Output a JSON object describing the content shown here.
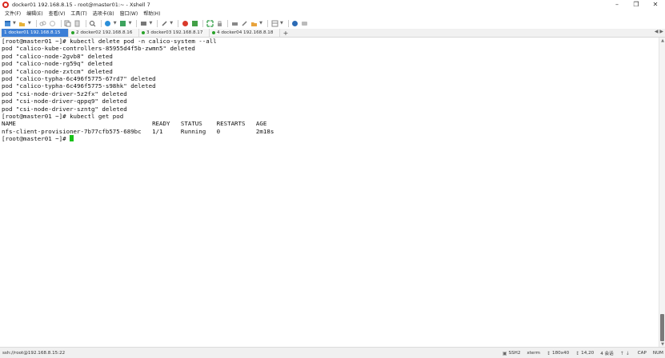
{
  "window": {
    "title": "docker01 192.168.8.15 - root@master01:~ - Xshell 7"
  },
  "menu": [
    "文件(F)",
    "编辑(E)",
    "查看(V)",
    "工具(T)",
    "选项卡(B)",
    "窗口(W)",
    "帮助(H)"
  ],
  "tabs": [
    {
      "label": "1 docker01 192.168.8.15",
      "active": true
    },
    {
      "label": "2 docker02 192.168.8.16",
      "active": false
    },
    {
      "label": "3 docker03 192.168.8.17",
      "active": false
    },
    {
      "label": "4 docker04 192.168.8.18",
      "active": false
    }
  ],
  "terminal": {
    "lines": [
      "[root@master01 ~]# kubectl delete pod -n calico-system --all",
      "pod \"calico-kube-controllers-85955d4f5b-zwmn5\" deleted",
      "pod \"calico-node-2gvb8\" deleted",
      "pod \"calico-node-rg59q\" deleted",
      "pod \"calico-node-zxtcm\" deleted",
      "pod \"calico-typha-6c496f5775-67rd7\" deleted",
      "pod \"calico-typha-6c496f5775-s98hk\" deleted",
      "pod \"csi-node-driver-5z2fx\" deleted",
      "pod \"csi-node-driver-qppq9\" deleted",
      "pod \"csi-node-driver-szntg\" deleted",
      "[root@master01 ~]# kubectl get pod",
      "NAME                                      READY   STATUS    RESTARTS   AGE",
      "nfs-client-provisioner-7b77cfb575-689bc   1/1     Running   0          2m18s"
    ],
    "prompt": "[root@master01 ~]# ",
    "cursor_color": "#19c219"
  },
  "status": {
    "connection": "ssh://root@192.168.8.15:22",
    "protocol": "SSH2",
    "term": "xterm",
    "size": "180x40",
    "position": "14,20",
    "sessions": "4 会话",
    "caps": "CAP",
    "num": "NUM"
  },
  "colors": {
    "active_tab": "#3d7fd6",
    "cursor": "#19c219"
  }
}
